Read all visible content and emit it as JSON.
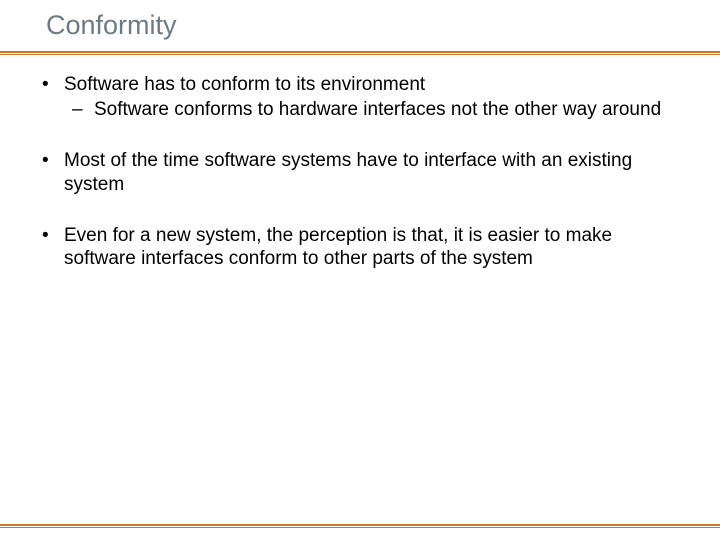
{
  "title": "Conformity",
  "bullets": [
    {
      "text": "Software has to conform to its environment",
      "sub": [
        "Software conforms to hardware interfaces not the other way around"
      ]
    },
    {
      "text": "Most of the time software systems have to interface with an existing system",
      "sub": []
    },
    {
      "text": "Even for a new system, the perception is that, it is easier to make software interfaces conform to other parts of the system",
      "sub": []
    }
  ]
}
